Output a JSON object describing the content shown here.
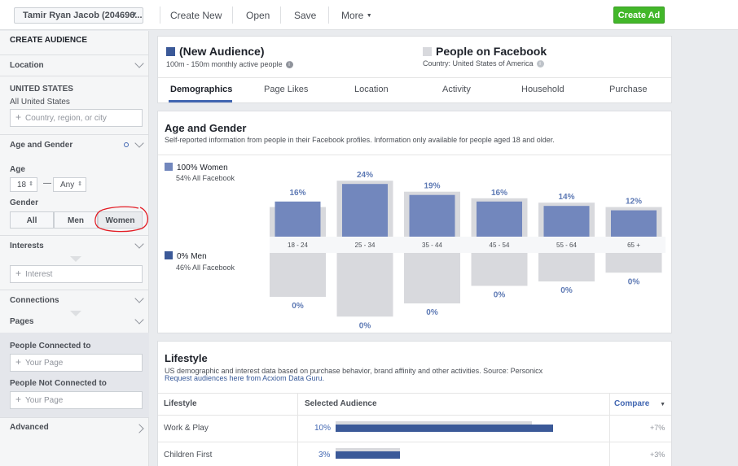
{
  "topbar": {
    "account": "Tamir Ryan Jacob (204696...",
    "create_new": "Create New",
    "open": "Open",
    "save": "Save",
    "more": "More",
    "create_ad": "Create Ad"
  },
  "sidebar": {
    "title": "CREATE AUDIENCE",
    "location_label": "Location",
    "country": "UNITED STATES",
    "country_sub": "All United States",
    "location_placeholder": "Country, region, or city",
    "age_gender_label": "Age and Gender",
    "age_label": "Age",
    "age_min": "18",
    "age_dash": "—",
    "age_max": "Any",
    "gender_label": "Gender",
    "gender_options": [
      "All",
      "Men",
      "Women"
    ],
    "gender_selected": "Women",
    "interests_label": "Interests",
    "interest_placeholder": "Interest",
    "connections_label": "Connections",
    "pages_label": "Pages",
    "people_connected_label": "People Connected to",
    "people_not_connected_label": "People Not Connected to",
    "your_page_placeholder": "Your Page",
    "advanced_label": "Advanced"
  },
  "summary": {
    "audience_title": "(New Audience)",
    "audience_size": "100m - 150m monthly active people",
    "compare_title": "People on Facebook",
    "compare_sub": "Country: United States of America",
    "audience_color": "#3b5998",
    "compare_color": "#d8d9dd"
  },
  "tabs": [
    "Demographics",
    "Page Likes",
    "Location",
    "Activity",
    "Household",
    "Purchase"
  ],
  "active_tab": "Demographics",
  "age_gender": {
    "title": "Age and Gender",
    "description": "Self-reported information from people in their Facebook profiles. Information only available for people aged 18 and older.",
    "women_legend": "100% Women",
    "women_sub": "54% All Facebook",
    "men_legend": "0% Men",
    "men_sub": "46% All Facebook"
  },
  "chart_data": {
    "type": "bar",
    "categories": [
      "18 - 24",
      "25 - 34",
      "35 - 44",
      "45 - 54",
      "55 - 64",
      "65 +"
    ],
    "series": [
      {
        "name": "100% Women",
        "values": [
          16,
          24,
          19,
          16,
          14,
          12
        ],
        "labels": [
          "16%",
          "24%",
          "19%",
          "16%",
          "14%",
          "12%"
        ]
      },
      {
        "name": "0% Men",
        "values": [
          0,
          0,
          0,
          0,
          0,
          0
        ],
        "labels": [
          "0%",
          "0%",
          "0%",
          "0%",
          "0%",
          "0%"
        ]
      }
    ],
    "colors": {
      "women": "#7287bd",
      "men": "#d8d9dd",
      "benchmark": "#d8d9dd"
    }
  },
  "lifestyle": {
    "title": "Lifestyle",
    "description": "US demographic and interest data based on purchase behavior, brand affinity and other activities. Source: Personicx",
    "link": "Request audiences here from Acxiom Data Guru.",
    "col_lifestyle": "Lifestyle",
    "col_selected": "Selected Audience",
    "col_compare": "Compare",
    "rows": [
      {
        "name": "Work & Play",
        "pct": "10%",
        "compare": "+7%",
        "value": 10
      },
      {
        "name": "Children First",
        "pct": "3%",
        "compare": "+3%",
        "value": 3
      }
    ]
  }
}
